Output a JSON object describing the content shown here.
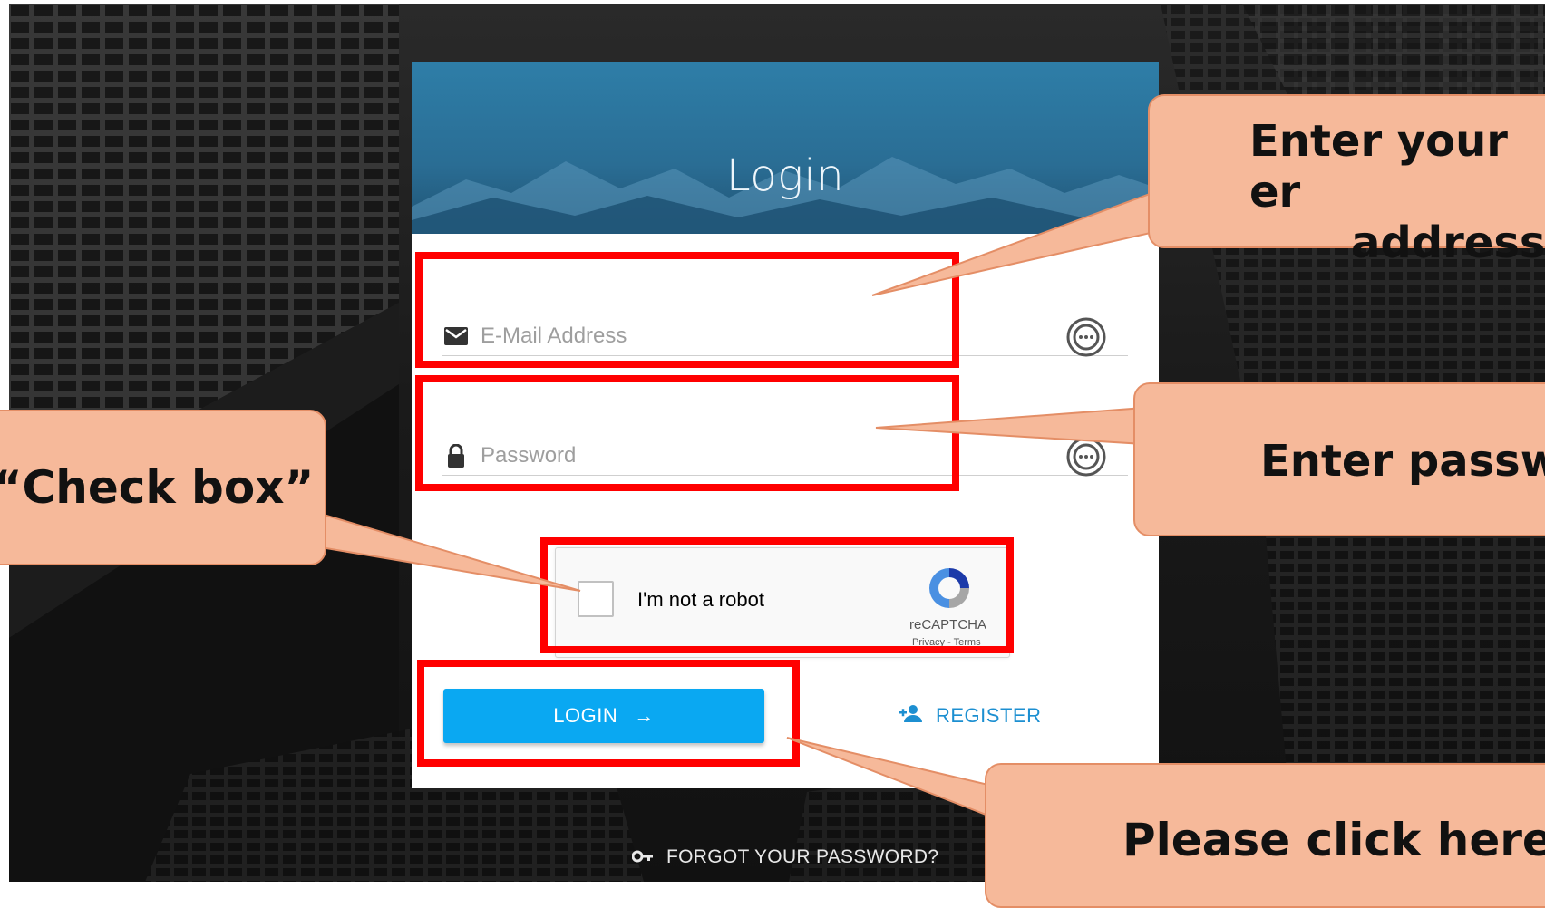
{
  "login_card": {
    "title": "Login",
    "email_placeholder": "E-Mail Address",
    "password_placeholder": "Password",
    "recaptcha": {
      "label": "I'm not a robot",
      "brand": "reCAPTCHA",
      "links": "Privacy - Terms"
    },
    "login_button": "LOGIN",
    "login_arrow": "→",
    "register_link": "REGISTER",
    "forgot_link": "FORGOT YOUR PASSWORD?"
  },
  "annotations": {
    "email_callout_line1": "Enter your er",
    "email_callout_line2": "address",
    "password_callout": "Enter passw",
    "checkbox_callout": "“Check box”",
    "login_callout": "Please click here"
  },
  "colors": {
    "header_blue": "#2a6d94",
    "button_blue": "#0aa8f2",
    "link_blue": "#1c8fd1",
    "highlight_red": "#ff0000",
    "callout_fill": "#f6b99a"
  }
}
